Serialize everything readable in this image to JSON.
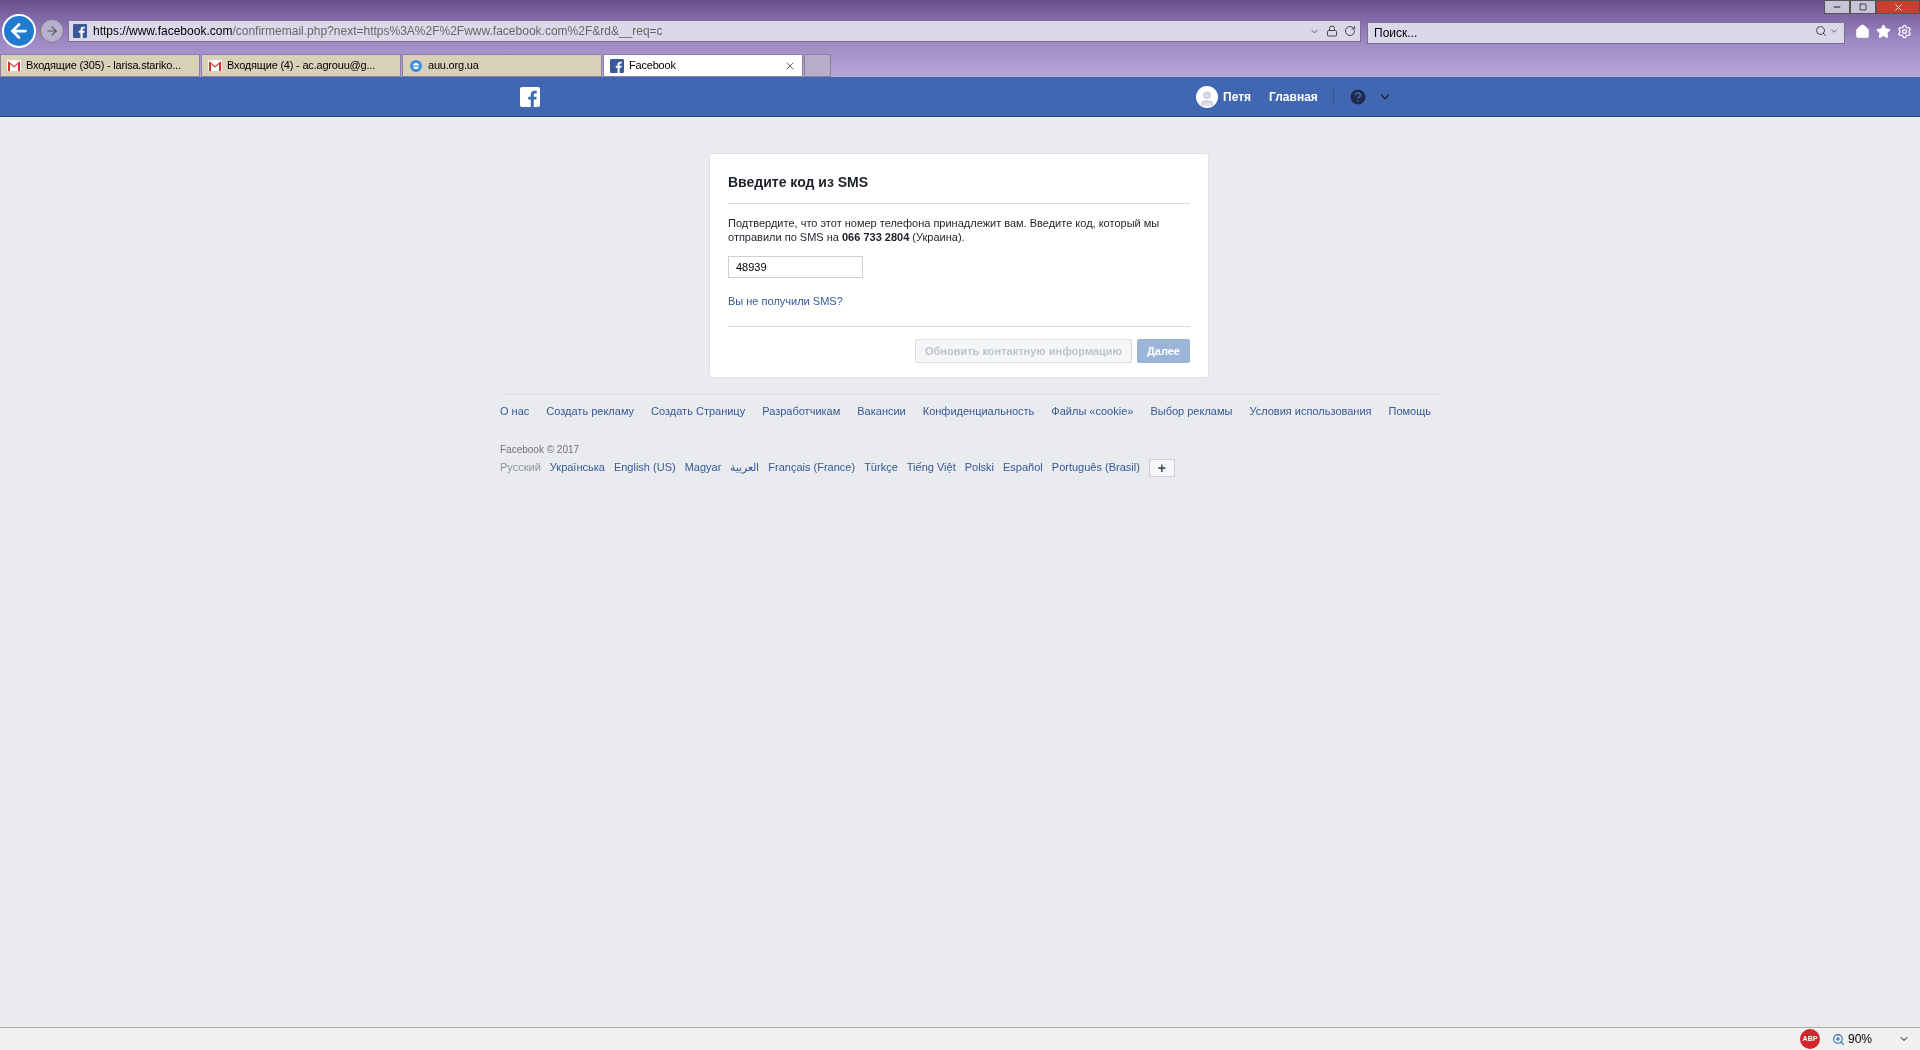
{
  "browser": {
    "url_host": "https://www.facebook.com",
    "url_rest": "/confirmemail.php?next=https%3A%2F%2Fwww.facebook.com%2F&rd&__req=c",
    "search": {
      "placeholder": "Поиск..."
    },
    "tabs": [
      {
        "label": "Входящие (305) - larisa.stariko...",
        "kind": "mail",
        "selected": false
      },
      {
        "label": "Входящие (4) - ac.agrouu@g...",
        "kind": "mail",
        "selected": false
      },
      {
        "label": "auu.org.ua",
        "kind": "web",
        "selected": false
      },
      {
        "label": "Facebook",
        "kind": "social",
        "selected": true
      }
    ]
  },
  "header": {
    "user": "Петя",
    "home": "Главная"
  },
  "card": {
    "title": "Введите код из SMS",
    "description": "Подтвердите, что этот номер телефона принадлежит вам. Введите код, который мы отправили по SMS на **066 733 2804** (Украина).",
    "code": "48939",
    "resend_link": "Вы не получили SMS?",
    "buttons": [
      {
        "label": "Обновить контактную информацию",
        "kind": "secondary",
        "disabled": true
      },
      {
        "label": "Далее",
        "kind": "primary",
        "disabled": true
      }
    ]
  },
  "footer": {
    "links": [
      "О нас",
      "Создать рекламу",
      "Создать Страницу",
      "Разработчикам",
      "Вакансии",
      "Конфиденциальность",
      "Файлы «cookie»",
      "Выбор рекламы",
      "Условия использования",
      "Помощь"
    ],
    "copyright": "Facebook © 2017",
    "languages": [
      {
        "label": "Русский",
        "selected": true
      },
      {
        "label": "Українська",
        "selected": false
      },
      {
        "label": "English (US)",
        "selected": false
      },
      {
        "label": "Magyar",
        "selected": false
      },
      {
        "label": "العربية",
        "selected": false
      },
      {
        "label": "Français (France)",
        "selected": false
      },
      {
        "label": "Türkçe",
        "selected": false
      },
      {
        "label": "Tiếng Việt",
        "selected": false
      },
      {
        "label": "Polski",
        "selected": false
      },
      {
        "label": "Español",
        "selected": false
      },
      {
        "label": "Português (Brasil)",
        "selected": false
      }
    ],
    "more_button": "+"
  },
  "status_bar": {
    "adblock": "ABP",
    "zoom": "90%"
  }
}
